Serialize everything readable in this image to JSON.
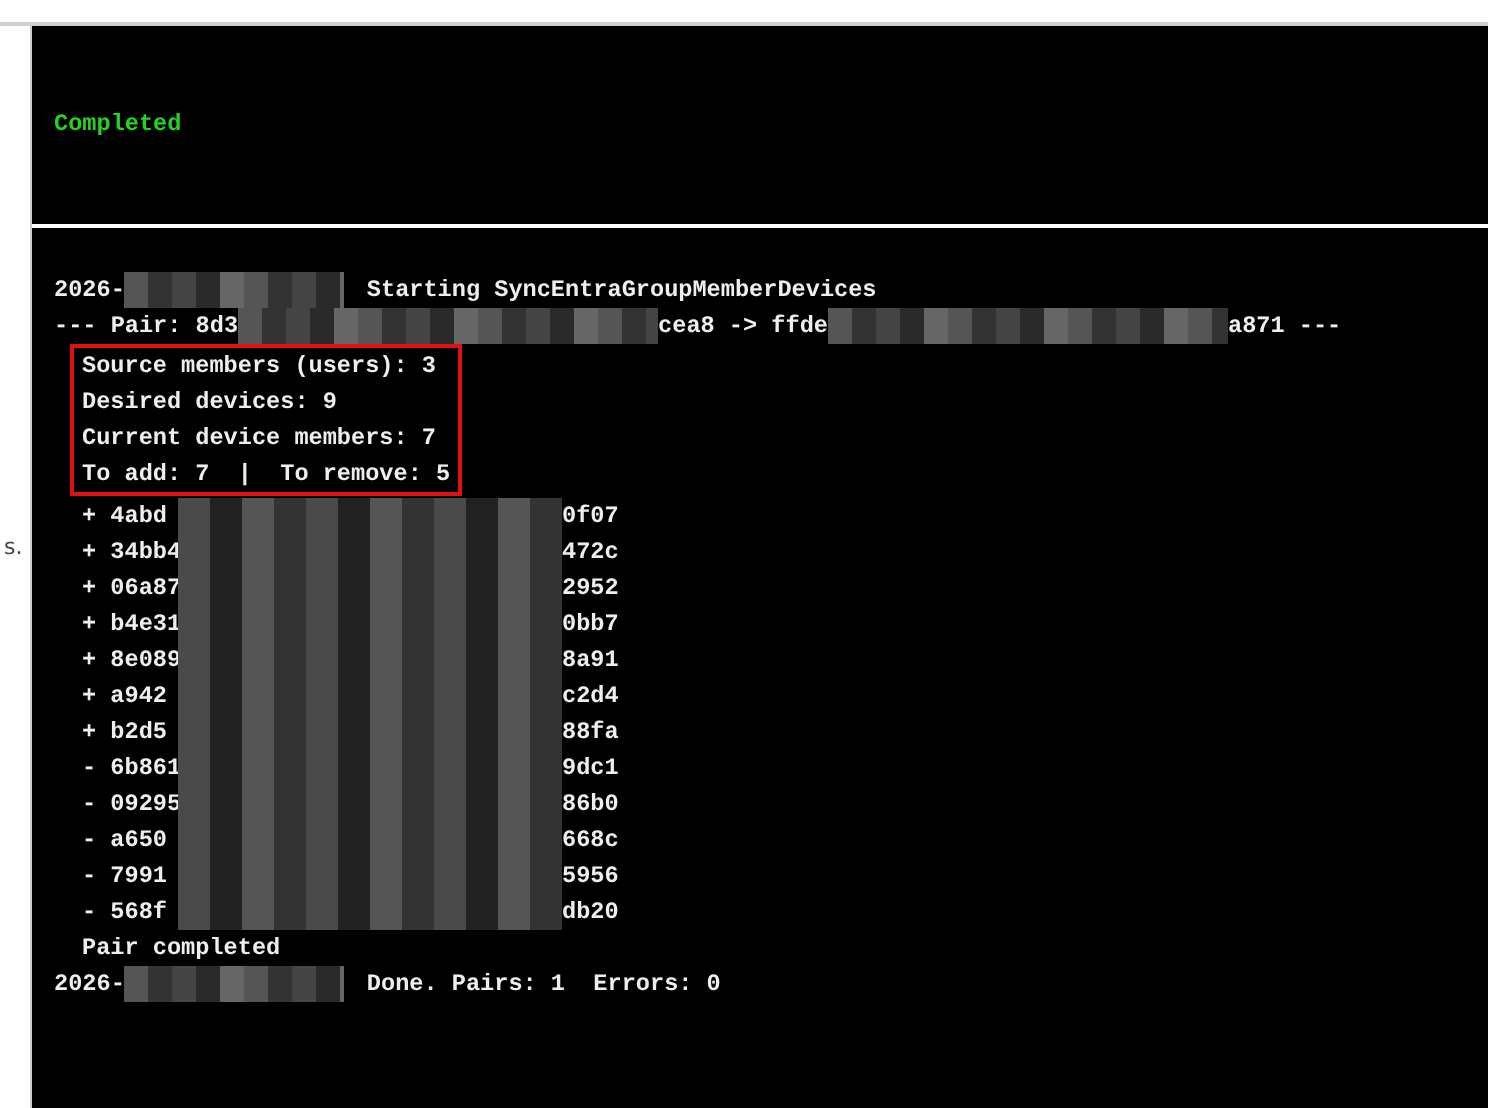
{
  "status_panel": {
    "status": "Completed"
  },
  "side_fragment": "s.",
  "log": [
    {
      "kind": "line",
      "segments": [
        {
          "kind": "text",
          "text": "2026-"
        },
        {
          "kind": "redacted"
        },
        {
          "kind": "text",
          "text": "Starting SyncEntraGroupMemberDevices"
        }
      ]
    },
    {
      "kind": "line",
      "segments": [
        {
          "kind": "text",
          "text": "--- Pair: 8d3"
        },
        {
          "kind": "redacted"
        },
        {
          "kind": "text",
          "text": "cea8 -> ffde"
        },
        {
          "kind": "redacted"
        },
        {
          "kind": "text",
          "text": "a871 ---"
        }
      ]
    },
    {
      "kind": "summary",
      "lines": [
        "Source members (users): 3",
        "Desired devices: 9",
        "Current device members: 7",
        "To add: 7  |  To remove: 5"
      ]
    },
    {
      "kind": "members",
      "rows": [
        {
          "prefix": "+ 4abd",
          "suffix": "0f07"
        },
        {
          "prefix": "+ 34bb4",
          "suffix": "472c"
        },
        {
          "prefix": "+ 06a87",
          "suffix": "2952"
        },
        {
          "prefix": "+ b4e31",
          "suffix": "0bb7"
        },
        {
          "prefix": "+ 8e089",
          "suffix": "8a91"
        },
        {
          "prefix": "+ a942",
          "suffix": "c2d4"
        },
        {
          "prefix": "+ b2d5",
          "suffix": "88fa"
        },
        {
          "prefix": "- 6b861",
          "suffix": "9dc1"
        },
        {
          "prefix": "- 09295",
          "suffix": "86b0"
        },
        {
          "prefix": "- a650",
          "suffix": "668c"
        },
        {
          "prefix": "- 7991",
          "suffix": "5956"
        },
        {
          "prefix": "- 568f",
          "suffix": "db20"
        }
      ]
    },
    {
      "kind": "indented",
      "text": "Pair completed"
    },
    {
      "kind": "line",
      "segments": [
        {
          "kind": "text",
          "text": "2026-"
        },
        {
          "kind": "redacted"
        },
        {
          "kind": "text",
          "text": "Done. Pairs: 1  Errors: 0"
        }
      ]
    }
  ]
}
